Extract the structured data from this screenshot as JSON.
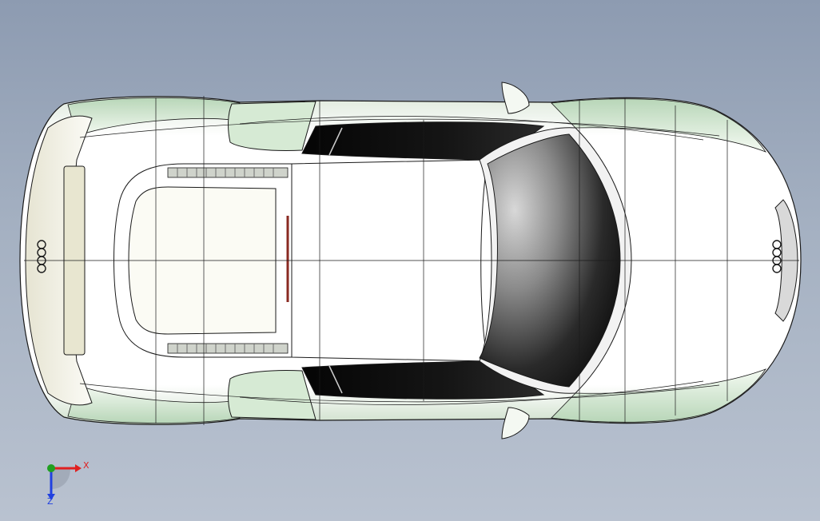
{
  "view": {
    "background_top": "#8d9bb1",
    "background_bottom": "#b9c2d0",
    "model": "car-body-top-view"
  },
  "triad": {
    "x_label": "X",
    "z_label": "Z",
    "x_color": "#e02020",
    "y_color": "#20a020",
    "z_color": "#2040e0"
  }
}
